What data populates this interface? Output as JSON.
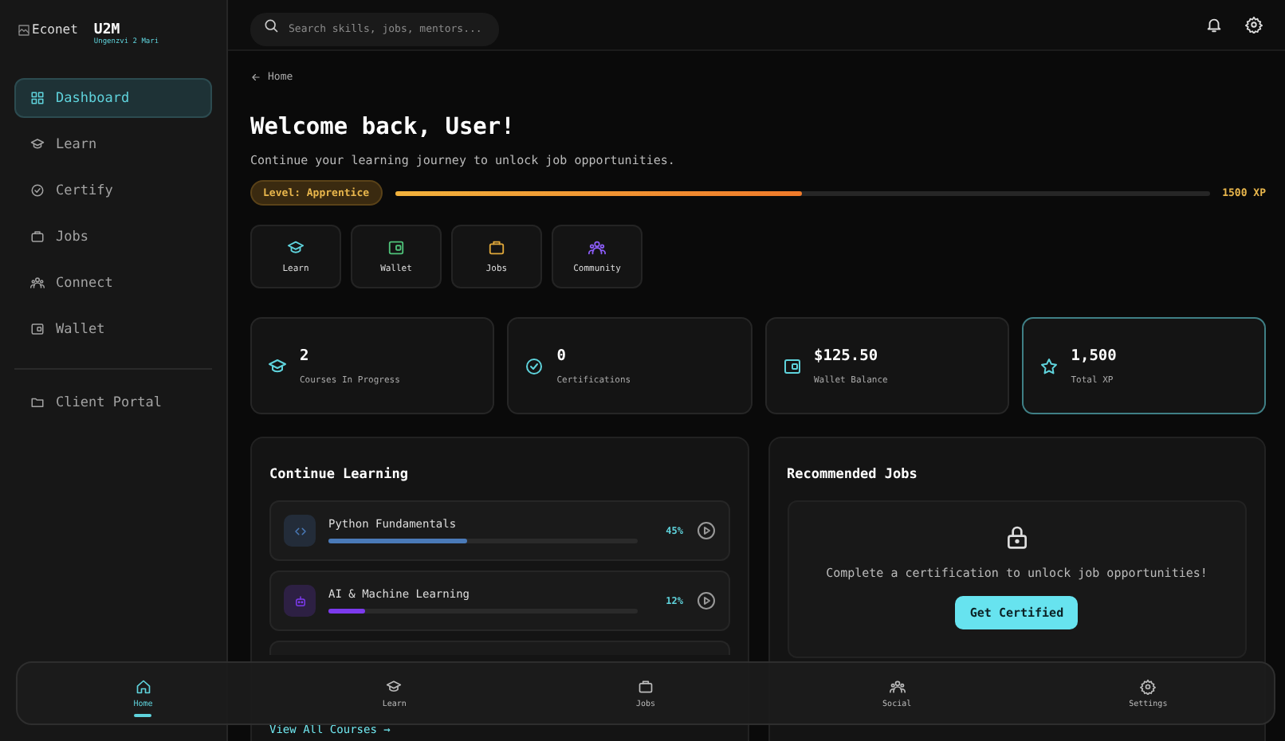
{
  "sidebar": {
    "logo_alt": "Econet",
    "brand": "U2M",
    "tagline": "Ungenzvi 2 Mari",
    "items": [
      {
        "label": "Dashboard",
        "selected": true
      },
      {
        "label": "Learn",
        "selected": false
      },
      {
        "label": "Certify",
        "selected": false
      },
      {
        "label": "Jobs",
        "selected": false
      },
      {
        "label": "Connect",
        "selected": false
      },
      {
        "label": "Wallet",
        "selected": false
      }
    ],
    "footer_item": {
      "label": "Client Portal"
    }
  },
  "top_bar": {
    "search": {
      "placeholder": "Search skills, jobs, mentors..."
    }
  },
  "breadcrumb": "Home",
  "heading": "Welcome back, User!",
  "subtitle": "Continue your learning journey to unlock job opportunities.",
  "level": {
    "badge": "Level: Apprentice",
    "level": 0.5,
    "reading": "1500 XP"
  },
  "quick_actions": [
    {
      "label": "Learn",
      "color": "#5fd3dc"
    },
    {
      "label": "Wallet",
      "color": "#4fc37a"
    },
    {
      "label": "Jobs",
      "color": "#e0a83a"
    },
    {
      "label": "Community",
      "color": "#8b5cf6"
    }
  ],
  "stats": [
    {
      "value": "2",
      "label": "Courses In Progress",
      "selected": false
    },
    {
      "value": "0",
      "label": "Certifications",
      "selected": false
    },
    {
      "value": "$125.50",
      "label": "Wallet Balance",
      "selected": false
    },
    {
      "value": "1,500",
      "label": "Total XP",
      "selected": true
    }
  ],
  "continue_learning": {
    "title": "Continue Learning",
    "courses": [
      {
        "name": "Python Fundamentals",
        "percent": "45%",
        "level": 0.45,
        "color": "#4a7ab8"
      },
      {
        "name": "AI & Machine Learning",
        "percent": "12%",
        "level": 0.12,
        "color": "#7c3aed"
      }
    ],
    "link": "View All Courses →"
  },
  "recommended_jobs": {
    "title": "Recommended Jobs",
    "message": "Complete a certification to unlock job opportunities!",
    "button": "Get Certified"
  },
  "bottom_nav": [
    {
      "label": "Home",
      "selected": true
    },
    {
      "label": "Learn",
      "selected": false
    },
    {
      "label": "Jobs",
      "selected": false
    },
    {
      "label": "Social",
      "selected": false
    },
    {
      "label": "Settings",
      "selected": false
    }
  ]
}
